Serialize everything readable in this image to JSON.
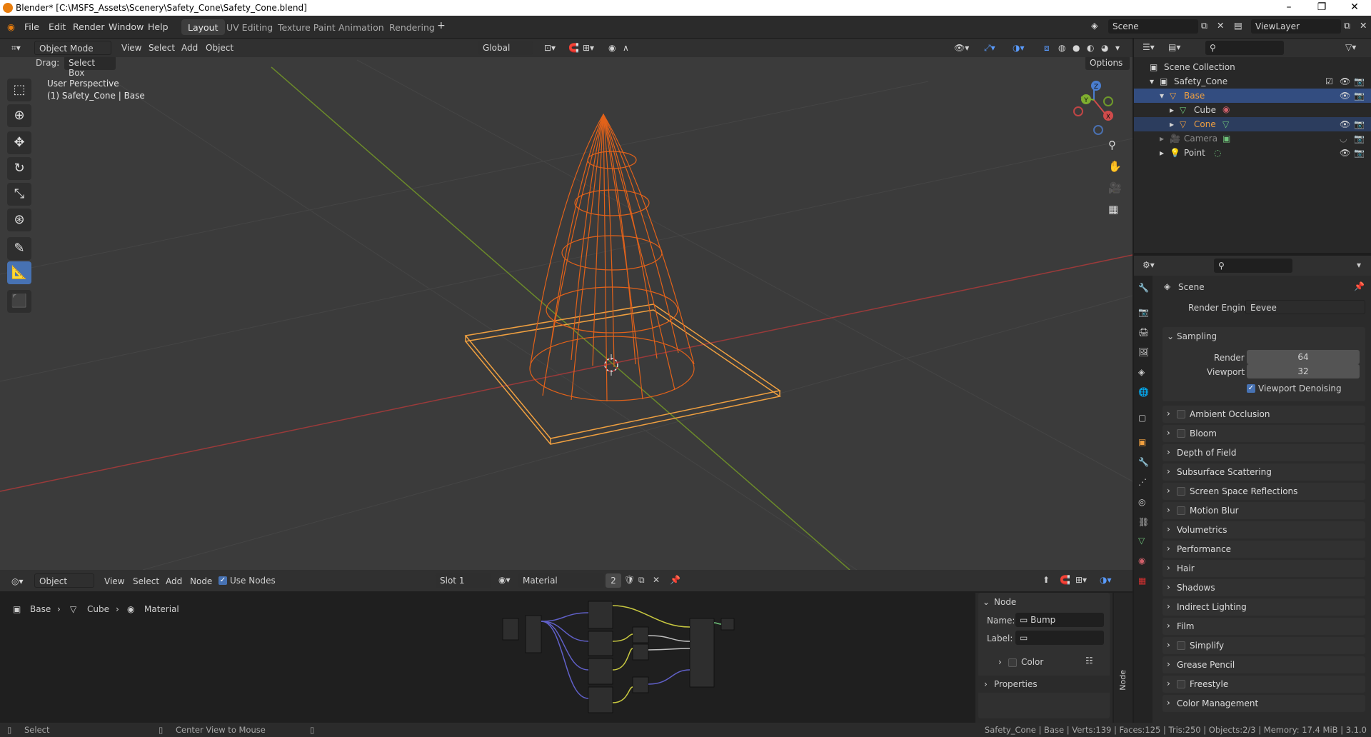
{
  "window": {
    "title": "Blender* [C:\\MSFS_Assets\\Scenery\\Safety_Cone\\Safety_Cone.blend]"
  },
  "menu": {
    "items": [
      "File",
      "Edit",
      "Render",
      "Window",
      "Help"
    ]
  },
  "workspaces": [
    "Layout",
    "UV Editing",
    "Texture Paint",
    "Animation",
    "Rendering"
  ],
  "scene": {
    "label": "Scene",
    "view_layer": "ViewLayer"
  },
  "viewport": {
    "mode": "Object Mode",
    "menus": [
      "View",
      "Select",
      "Add",
      "Object"
    ],
    "transform": "Global",
    "drag_label": "Drag:",
    "drag_value": "Select Box",
    "options": "Options",
    "overlay_title": "User Perspective",
    "overlay_sub": "(1) Safety_Cone | Base",
    "gizmo_axes": [
      "X",
      "Y",
      "Z"
    ]
  },
  "outliner": {
    "root": "Scene Collection",
    "items": [
      {
        "label": "Safety_Cone"
      },
      {
        "label": "Base"
      },
      {
        "label": "Cube"
      },
      {
        "label": "Cone"
      },
      {
        "label": "Camera"
      },
      {
        "label": "Point"
      }
    ]
  },
  "properties": {
    "context": "Scene",
    "render_engine_label": "Render Engine",
    "render_engine": "Eevee",
    "sampling": {
      "title": "Sampling",
      "render_label": "Render",
      "render": "64",
      "viewport_label": "Viewport",
      "viewport": "32",
      "denoise": "Viewport Denoising"
    },
    "panels": [
      "Ambient Occlusion",
      "Bloom",
      "Depth of Field",
      "Subsurface Scattering",
      "Screen Space Reflections",
      "Motion Blur",
      "Volumetrics",
      "Performance",
      "Hair",
      "Shadows",
      "Indirect Lighting",
      "Film",
      "Simplify",
      "Grease Pencil",
      "Freestyle",
      "Color Management"
    ],
    "panels_with_checkbox": [
      true,
      true,
      false,
      false,
      true,
      true,
      false,
      false,
      false,
      false,
      false,
      false,
      true,
      false,
      true,
      false
    ]
  },
  "node_editor": {
    "object": "Object",
    "menus": [
      "View",
      "Select",
      "Add",
      "Node"
    ],
    "use_nodes": "Use Nodes",
    "slot": "Slot 1",
    "material": "Material",
    "users": "2",
    "breadcrumb": [
      "Base",
      "Cube",
      "Material"
    ],
    "side": {
      "title": "Node",
      "name_label": "Name:",
      "name": "Bump",
      "label_label": "Label:",
      "label": "",
      "color": "Color",
      "properties": "Properties",
      "tab": "Node"
    }
  },
  "status": {
    "select": "Select",
    "center": "Center View to Mouse",
    "stats": "Safety_Cone | Base | Verts:139 | Faces:125 | Tris:250 | Objects:2/3 | Memory: 17.4 MiB | 3.1.0"
  }
}
